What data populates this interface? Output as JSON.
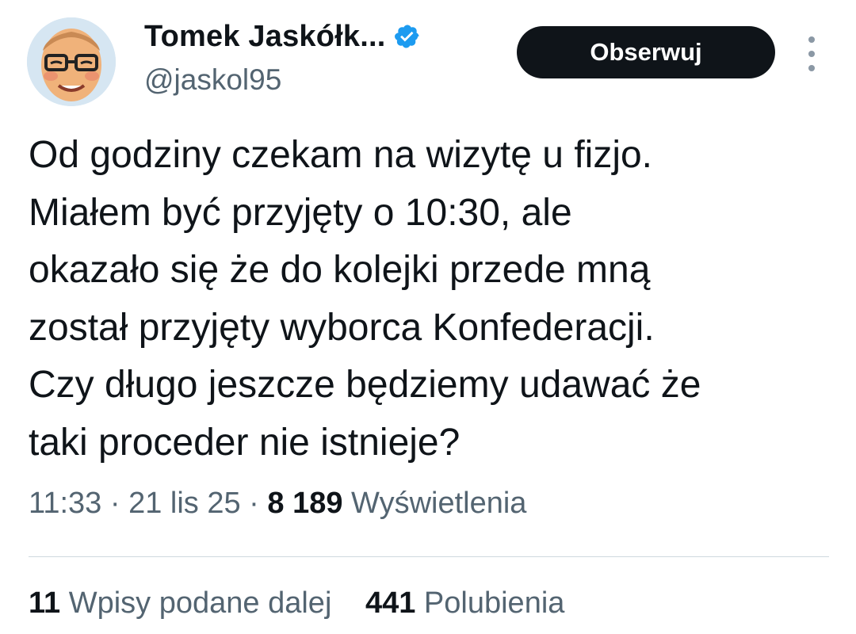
{
  "author": {
    "display_name": "Tomek Jaskółk...",
    "handle": "@jaskol95",
    "verified_icon": "verified-badge-icon",
    "verified_color": "#1d9bf0"
  },
  "actions": {
    "follow_label": "Obserwuj",
    "more_icon": "more-vertical-icon"
  },
  "tweet": {
    "lines": [
      "Od godziny czekam na wizytę u fizjo.",
      "Miałem być przyjęty o 10:30, ale",
      "okazało się że do kolejki przede mną",
      "został przyjęty wyborca Konfederacji.",
      "Czy długo jeszcze będziemy udawać że",
      "taki proceder nie istnieje?"
    ]
  },
  "meta": {
    "time": "11:33",
    "separator": "·",
    "date": "21 lis 25",
    "views_count": "8 189",
    "views_label": "Wyświetlenia"
  },
  "stats": {
    "reposts_count": "11",
    "reposts_label": "Wpisy podane dalej",
    "likes_count": "441",
    "likes_label": "Polubienia"
  },
  "colors": {
    "text_primary": "#0f1419",
    "text_secondary": "#536471",
    "button_bg": "#0f1419",
    "divider": "#cfd9de"
  }
}
